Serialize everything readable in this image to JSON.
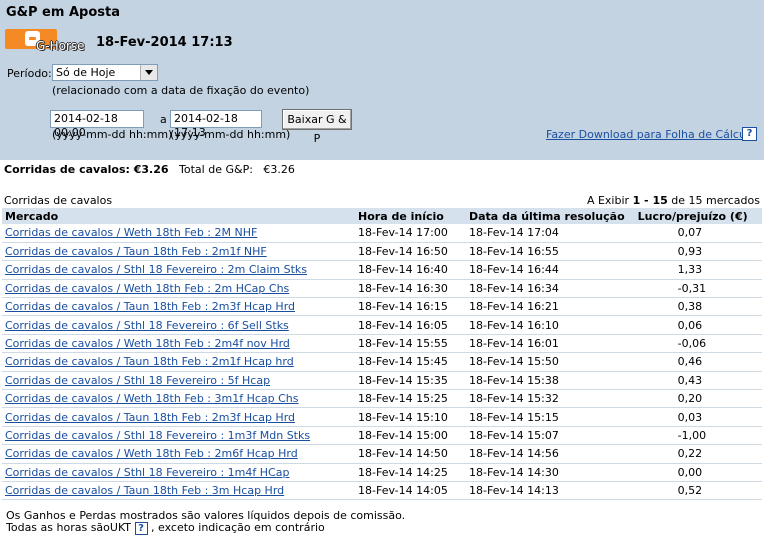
{
  "header": {
    "title": "G&P em Aposta",
    "brand": "G-Horse",
    "datetime": "18-Fev-2014 17:13"
  },
  "filters": {
    "period_label": "Período:",
    "period_value": "Só de Hoje",
    "period_note": "(relacionado com a data de fixação do evento)",
    "from_value": "2014-02-18 00:00",
    "separator": "a",
    "to_value": "2014-02-18 17:13",
    "download_button": "Baixar G & P",
    "from_format": "(yyyy-mm-dd hh:mm)",
    "to_format": "(yyyy-mm-dd hh:mm)",
    "spreadsheet_link": "Fazer Download para Folha de Cálculo",
    "help": "?"
  },
  "summary": {
    "horse_label": "Corridas de cavalos: €3.26",
    "total_label": "Total de G&P:",
    "total_value": "€3.26"
  },
  "results": {
    "section_title": "Corridas de cavalos",
    "pager_prefix": "A Exibir",
    "pager_range": "1 - 15",
    "pager_suffix": "de 15 mercados",
    "columns": [
      "Mercado",
      "Hora de início",
      "Data da última resolução",
      "Lucro/prejuízo (€)"
    ],
    "rows": [
      {
        "market": "Corridas de cavalos / Weth 18th Feb : 2M NHF",
        "start": "18-Fev-14 17:00",
        "settled": "18-Fev-14 17:04",
        "pl": "0,07"
      },
      {
        "market": "Corridas de cavalos / Taun 18th Feb : 2m1f NHF",
        "start": "18-Fev-14 16:50",
        "settled": "18-Fev-14 16:55",
        "pl": "0,93"
      },
      {
        "market": "Corridas de cavalos / Sthl 18 Fevereiro : 2m Claim Stks",
        "start": "18-Fev-14 16:40",
        "settled": "18-Fev-14 16:44",
        "pl": "1,33"
      },
      {
        "market": "Corridas de cavalos / Weth 18th Feb : 2m HCap Chs",
        "start": "18-Fev-14 16:30",
        "settled": "18-Fev-14 16:34",
        "pl": "-0,31"
      },
      {
        "market": "Corridas de cavalos / Taun 18th Feb : 2m3f Hcap Hrd",
        "start": "18-Fev-14 16:15",
        "settled": "18-Fev-14 16:21",
        "pl": "0,38"
      },
      {
        "market": "Corridas de cavalos / Sthl 18 Fevereiro : 6f Sell Stks",
        "start": "18-Fev-14 16:05",
        "settled": "18-Fev-14 16:10",
        "pl": "0,06"
      },
      {
        "market": "Corridas de cavalos / Weth 18th Feb : 2m4f nov Hrd",
        "start": "18-Fev-14 15:55",
        "settled": "18-Fev-14 16:01",
        "pl": "-0,06"
      },
      {
        "market": "Corridas de cavalos / Taun 18th Feb : 2m1f Hcap hrd",
        "start": "18-Fev-14 15:45",
        "settled": "18-Fev-14 15:50",
        "pl": "0,46"
      },
      {
        "market": "Corridas de cavalos / Sthl 18 Fevereiro : 5f Hcap",
        "start": "18-Fev-14 15:35",
        "settled": "18-Fev-14 15:38",
        "pl": "0,43"
      },
      {
        "market": "Corridas de cavalos / Weth 18th Feb : 3m1f Hcap Chs",
        "start": "18-Fev-14 15:25",
        "settled": "18-Fev-14 15:32",
        "pl": "0,20"
      },
      {
        "market": "Corridas de cavalos / Taun 18th Feb : 2m3f Hcap Hrd",
        "start": "18-Fev-14 15:10",
        "settled": "18-Fev-14 15:15",
        "pl": "0,03"
      },
      {
        "market": "Corridas de cavalos / Sthl 18 Fevereiro : 1m3f Mdn Stks",
        "start": "18-Fev-14 15:00",
        "settled": "18-Fev-14 15:07",
        "pl": "-1,00"
      },
      {
        "market": "Corridas de cavalos / Weth 18th Feb : 2m6f Hcap Hrd",
        "start": "18-Fev-14 14:50",
        "settled": "18-Fev-14 14:56",
        "pl": "0,22"
      },
      {
        "market": "Corridas de cavalos / Sthl 18 Fevereiro : 1m4f HCap",
        "start": "18-Fev-14 14:25",
        "settled": "18-Fev-14 14:30",
        "pl": "0,00"
      },
      {
        "market": "Corridas de cavalos / Taun 18th Feb : 3m Hcap Hrd",
        "start": "18-Fev-14 14:05",
        "settled": "18-Fev-14 14:13",
        "pl": "0,52"
      }
    ]
  },
  "footer": {
    "note1": "Os Ganhos e Perdas mostrados são valores líquidos depois de comissão.",
    "note2_prefix": "Todas as horas sãoUKT",
    "note2_help": "?",
    "note2_suffix": ", exceto indicação em contrário"
  },
  "colors": {
    "panel": "#c3d3e2",
    "header_row": "#d5e1ec",
    "link": "#1a4fa0",
    "logo": "#f58a24"
  },
  "icons": [
    "blogger-logo-icon",
    "dropdown-arrow-icon",
    "help-icon"
  ]
}
